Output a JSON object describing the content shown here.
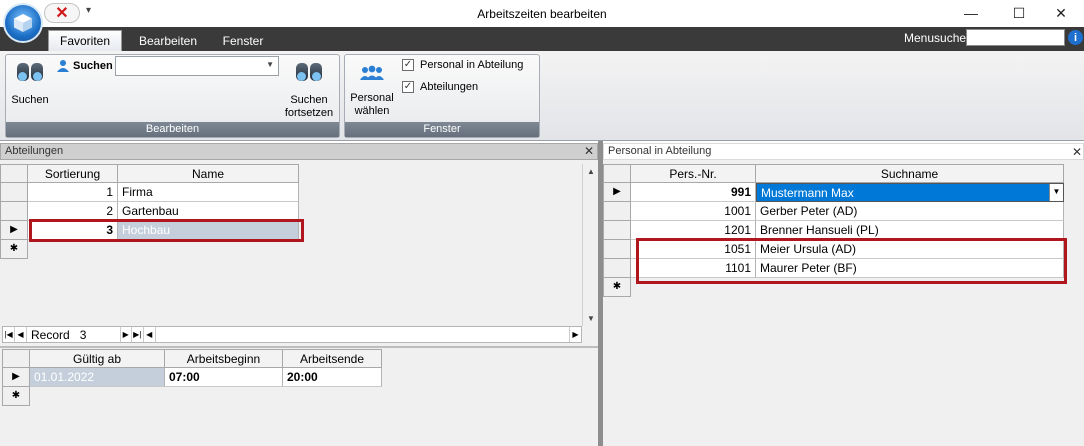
{
  "window": {
    "title": "Arbeitszeiten bearbeiten",
    "minimize": "—",
    "maximize": "☐",
    "close": "✕"
  },
  "qat": {
    "close_glyph": "✕",
    "dropdown": "▾"
  },
  "ribbon": {
    "tabs": [
      "Favoriten",
      "Bearbeiten",
      "Fenster"
    ],
    "active_tab": "Favoriten",
    "menusuche_label": "Menusuche",
    "help": "i",
    "groups": {
      "bearbeiten": {
        "label": "Bearbeiten",
        "suchen_button": "Suchen",
        "suchen_small": "Suchen",
        "dropdown_value": "",
        "suchen_fortsetzen_1": "Suchen",
        "suchen_fortsetzen_2": "fortsetzen"
      },
      "fenster": {
        "label": "Fenster",
        "personal_waehlen_1": "Personal",
        "personal_waehlen_2": "wählen",
        "check_personal": "Personal in Abteilung",
        "check_abteilungen": "Abteilungen",
        "check_personal_checked": true,
        "check_abteilungen_checked": true
      }
    }
  },
  "abteilungen": {
    "title": "Abteilungen",
    "columns": [
      "Sortierung",
      "Name"
    ],
    "rows": [
      {
        "sort": "1",
        "name": "Firma"
      },
      {
        "sort": "2",
        "name": "Gartenbau"
      },
      {
        "sort": "3",
        "name": "Hochbau"
      }
    ],
    "current_row_index": 2,
    "new_row_marker": "✱",
    "current_marker": "▶",
    "nav": {
      "record_label": "Record",
      "record_value": "3"
    }
  },
  "arbeitszeiten": {
    "columns": [
      "Gültig ab",
      "Arbeitsbeginn",
      "Arbeitsende"
    ],
    "rows": [
      {
        "gueltig": "01.01.2022",
        "beginn": "07:00",
        "ende": "20:00"
      }
    ]
  },
  "personal": {
    "title": "Personal in Abteilung",
    "columns": [
      "Pers.-Nr.",
      "Suchname"
    ],
    "rows": [
      {
        "nr": "991",
        "name": "Mustermann Max"
      },
      {
        "nr": "1001",
        "name": "Gerber Peter (AD)"
      },
      {
        "nr": "1201",
        "name": "Brenner Hansueli (PL)"
      },
      {
        "nr": "1051",
        "name": "Meier Ursula (AD)"
      },
      {
        "nr": "1101",
        "name": "Maurer Peter (BF)"
      }
    ]
  },
  "colors": {
    "highlight_border": "#b0161e",
    "selection_blue": "#0078d7",
    "ribbon_dark": "#3a3a3a"
  }
}
